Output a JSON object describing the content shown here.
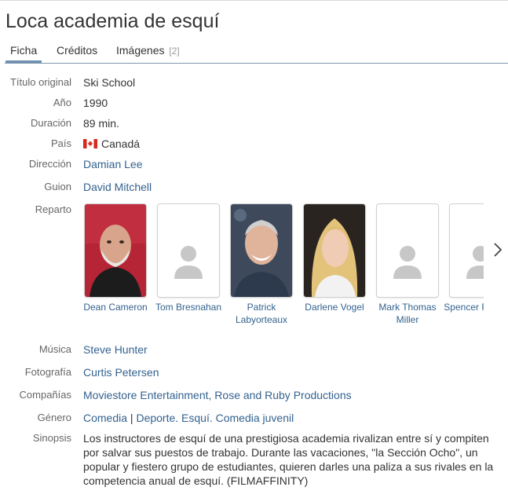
{
  "page": {
    "title": "Loca academia de esquí"
  },
  "tabs": [
    {
      "label": "Ficha",
      "count": ""
    },
    {
      "label": "Créditos",
      "count": ""
    },
    {
      "label": "Imágenes",
      "count": "[2]"
    }
  ],
  "info": {
    "original_title": {
      "label": "Título original",
      "value": "Ski School"
    },
    "year": {
      "label": "Año",
      "value": "1990"
    },
    "duration": {
      "label": "Duración",
      "value": "89 min."
    },
    "country": {
      "label": "País",
      "value": "Canadá",
      "flag_icon": "canada-flag-icon"
    },
    "director": {
      "label": "Dirección",
      "value": "Damian Lee"
    },
    "screenplay": {
      "label": "Guion",
      "value": "David Mitchell"
    },
    "cast": {
      "label": "Reparto",
      "members": [
        {
          "name": "Dean Cameron",
          "photo": true
        },
        {
          "name": "Tom Bresnahan",
          "photo": false
        },
        {
          "name": "Patrick Labyorteaux",
          "photo": true
        },
        {
          "name": "Darlene Vogel",
          "photo": true
        },
        {
          "name": "Mark Thomas Miller",
          "photo": false
        },
        {
          "name": "Spencer Rochfort",
          "photo": false
        }
      ],
      "next_icon": "chevron-right-icon"
    },
    "music": {
      "label": "Música",
      "value": "Steve Hunter"
    },
    "photography": {
      "label": "Fotografía",
      "value": "Curtis Petersen"
    },
    "companies": {
      "label": "Compañías",
      "value": "Moviestore Entertainment, Rose and Ruby Productions"
    },
    "genre": {
      "label": "Género",
      "primary": "Comedia",
      "separator": " | ",
      "secondary": "Deporte. Esquí. Comedia juvenil"
    },
    "synopsis": {
      "label": "Sinopsis",
      "text": "Los instructores de esquí de una prestigiosa academia rivalizan entre sí y compiten por salvar sus puestos de trabajo. Durante las vacaciones, \"la Sección Ocho\", un popular y fiestero grupo de estudiantes, quieren darles una paliza a sus rivales en la competencia anual de esquí. (FILMAFFINITY)"
    }
  },
  "colors": {
    "link": "#33628f",
    "label": "#666666",
    "tab_underline": "#6f8fb0",
    "text": "#333333"
  }
}
